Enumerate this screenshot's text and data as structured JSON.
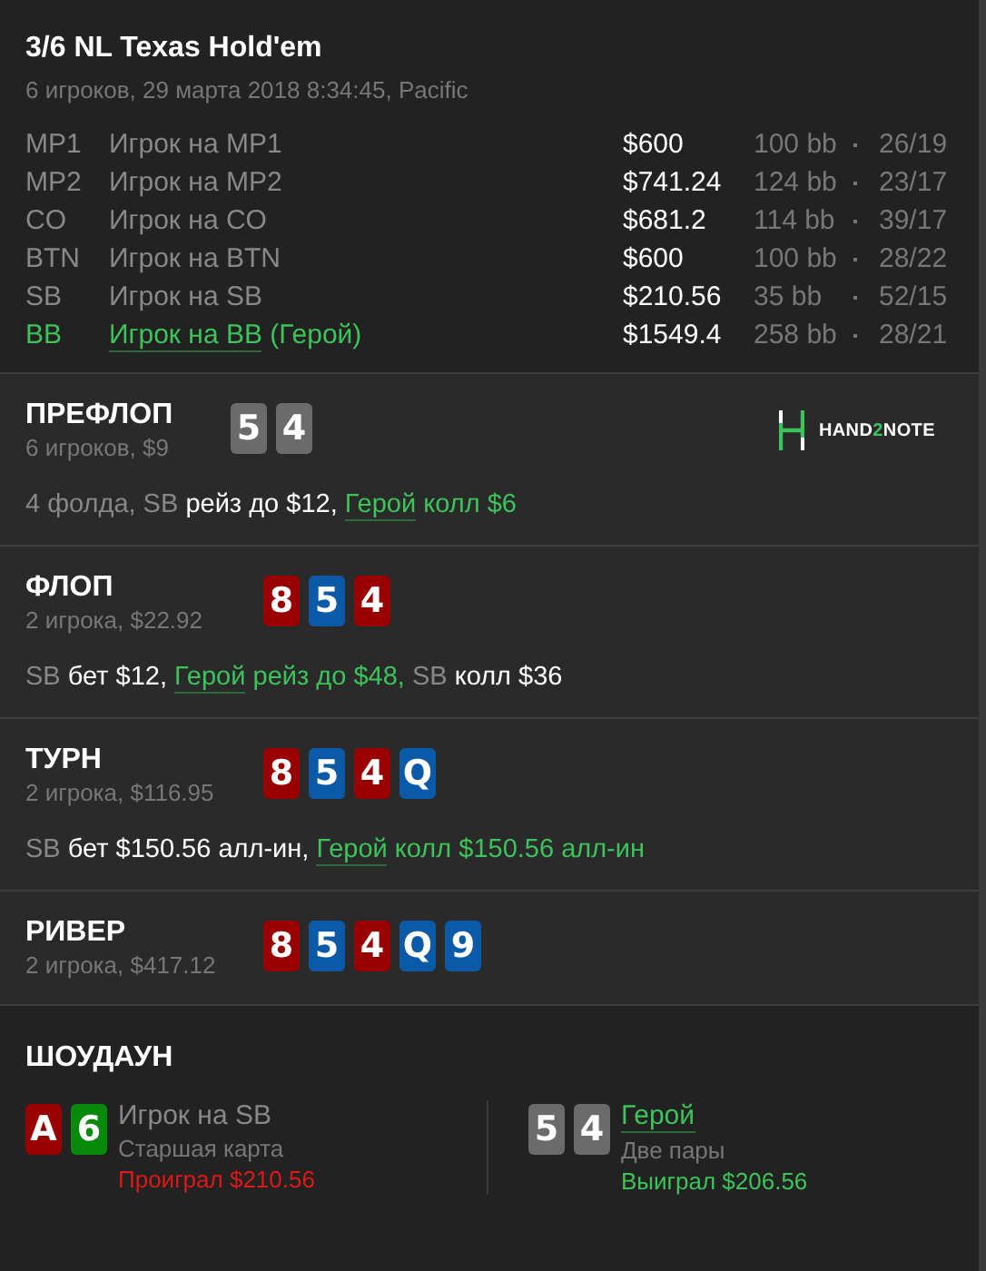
{
  "header": {
    "title": "3/6 NL Texas Hold'em",
    "subtitle": "6 игроков, 29 марта 2018 8:34:45, Pacific",
    "players": [
      {
        "position": "MP1",
        "name": "Игрок на MP1",
        "hero": false,
        "stack": "$600",
        "bb": "100 bb",
        "stats": "26/19"
      },
      {
        "position": "MP2",
        "name": "Игрок на MP2",
        "hero": false,
        "stack": "$741.24",
        "bb": "124 bb",
        "stats": "23/17"
      },
      {
        "position": "CO",
        "name": "Игрок на CO",
        "hero": false,
        "stack": "$681.2",
        "bb": "114 bb",
        "stats": "39/17"
      },
      {
        "position": "BTN",
        "name": "Игрок на BTN",
        "hero": false,
        "stack": "$600",
        "bb": "100 bb",
        "stats": "28/22"
      },
      {
        "position": "SB",
        "name": "Игрок на SB",
        "hero": false,
        "stack": "$210.56",
        "bb": "35 bb",
        "stats": "52/15"
      },
      {
        "position": "BB",
        "name": "Игрок на BB",
        "hero": true,
        "hero_label": "(Герой)",
        "stack": "$1549.4",
        "bb": "258 bb",
        "stats": "28/21"
      }
    ]
  },
  "logo": {
    "before": "HAND",
    "accent": "2",
    "after": "NOTE"
  },
  "streets": [
    {
      "title": "ПРЕФЛОП",
      "info": "6 игроков, $9",
      "kind": "hole",
      "cards": [
        {
          "rank": "5",
          "color": "#6b6b6b"
        },
        {
          "rank": "4",
          "color": "#6b6b6b"
        }
      ],
      "actions": [
        {
          "kind": "player",
          "text": "4 фолда, SB"
        },
        {
          "kind": "action",
          "text": "рейз до $12,"
        },
        {
          "kind": "hero",
          "text": "Герой"
        },
        {
          "kind": "hero_action",
          "text": "колл $6"
        }
      ]
    },
    {
      "title": "ФЛОП",
      "info": "2 игрока, $22.92",
      "kind": "board",
      "cards": [
        {
          "rank": "8",
          "color": "#990000"
        },
        {
          "rank": "5",
          "color": "#0b5aa8"
        },
        {
          "rank": "4",
          "color": "#990000"
        }
      ],
      "actions": [
        {
          "kind": "player",
          "text": "SB"
        },
        {
          "kind": "action",
          "text": "бет $12,"
        },
        {
          "kind": "hero",
          "text": "Герой"
        },
        {
          "kind": "hero_action",
          "text": "рейз до $48,"
        },
        {
          "kind": "player",
          "text": "SB"
        },
        {
          "kind": "action",
          "text": "колл $36"
        }
      ]
    },
    {
      "title": "ТУРН",
      "info": "2 игрока, $116.95",
      "kind": "board",
      "cards": [
        {
          "rank": "8",
          "color": "#990000"
        },
        {
          "rank": "5",
          "color": "#0b5aa8"
        },
        {
          "rank": "4",
          "color": "#990000"
        },
        {
          "rank": "Q",
          "color": "#0b5aa8"
        }
      ],
      "actions": [
        {
          "kind": "player",
          "text": "SB"
        },
        {
          "kind": "action",
          "text": "бет $150.56 алл-ин,"
        },
        {
          "kind": "hero",
          "text": "Герой"
        },
        {
          "kind": "hero_action",
          "text": "колл $150.56 алл-ин"
        }
      ]
    },
    {
      "title": "РИВЕР",
      "info": "2 игрока, $417.12",
      "kind": "board",
      "cards": [
        {
          "rank": "8",
          "color": "#990000"
        },
        {
          "rank": "5",
          "color": "#0b5aa8"
        },
        {
          "rank": "4",
          "color": "#990000"
        },
        {
          "rank": "Q",
          "color": "#0b5aa8"
        },
        {
          "rank": "9",
          "color": "#0b5aa8"
        }
      ]
    }
  ],
  "showdown": {
    "title": "ШОУДАУН",
    "hands": [
      {
        "name": "Игрок на SB",
        "hero": false,
        "hand": "Старшая карта",
        "result": "Проиграл $210.56",
        "kind": "lose",
        "cards": [
          {
            "rank": "A",
            "color": "#990000"
          },
          {
            "rank": "6",
            "color": "#0a8a0a"
          }
        ]
      },
      {
        "name": "Герой",
        "hero": true,
        "hand": "Две пары",
        "result": "Выиграл $206.56",
        "kind": "win",
        "cards": [
          {
            "rank": "5",
            "color": "#6b6b6b"
          },
          {
            "rank": "4",
            "color": "#6b6b6b"
          }
        ]
      }
    ]
  }
}
